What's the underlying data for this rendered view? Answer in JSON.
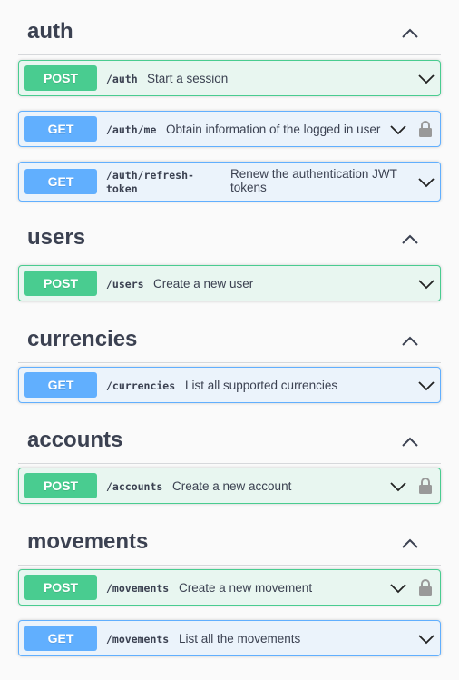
{
  "sections": [
    {
      "name": "auth",
      "ops": [
        {
          "method": "POST",
          "path": "/auth",
          "description": "Start a session"
        },
        {
          "method": "GET",
          "path": "/auth/me",
          "description": "Obtain information of the logged in user"
        },
        {
          "method": "GET",
          "path": "/auth/refresh-token",
          "path_line1": "/auth/refresh-",
          "path_line2": "token",
          "description": "Renew the authentication JWT tokens",
          "desc_line1": "Renew the authentication JWT",
          "desc_line2": "tokens"
        }
      ]
    },
    {
      "name": "users",
      "ops": [
        {
          "method": "POST",
          "path": "/users",
          "description": "Create a new user"
        }
      ]
    },
    {
      "name": "currencies",
      "ops": [
        {
          "method": "GET",
          "path": "/currencies",
          "description": "List all supported currencies"
        }
      ]
    },
    {
      "name": "accounts",
      "ops": [
        {
          "method": "POST",
          "path": "/accounts",
          "description": "Create a new account"
        }
      ]
    },
    {
      "name": "movements",
      "ops": [
        {
          "method": "POST",
          "path": "/movements",
          "description": "Create a new movement"
        },
        {
          "method": "GET",
          "path": "/movements",
          "description": "List all the movements"
        }
      ]
    }
  ],
  "colors": {
    "post": "#49cc90",
    "get": "#61affe",
    "post_bg": "#e8f6f0",
    "get_bg": "#ebf3fb",
    "text": "#3b4151"
  },
  "icons": {
    "section_toggle": "chevron-up-icon",
    "op_toggle": "chevron-down-icon",
    "auth": "lock-icon"
  }
}
